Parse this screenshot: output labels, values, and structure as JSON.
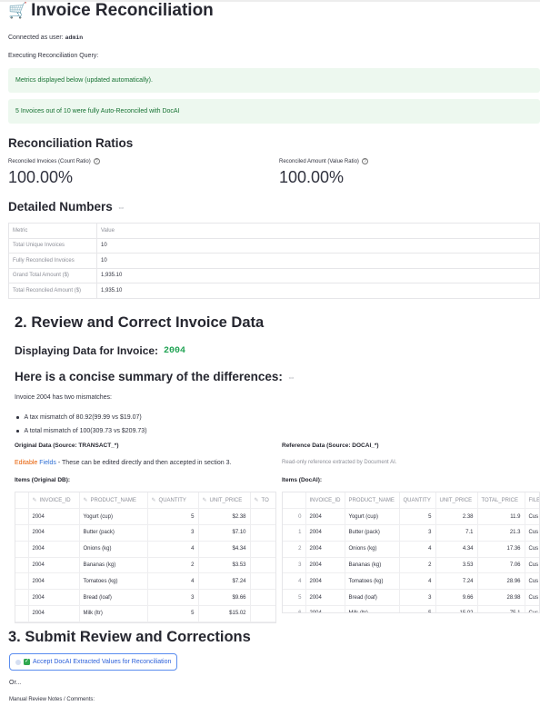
{
  "header": {
    "icon": "cart-icon",
    "title": "Invoice Reconciliation"
  },
  "connection": {
    "label": "Connected as user:",
    "user": "admin"
  },
  "executing": "Executing Reconciliation Query:",
  "alerts": {
    "metrics_note": "Metrics displayed below (updated automatically).",
    "auto_reconciled": "5 Invoices out of 10 were fully Auto-Reconciled with DocAI"
  },
  "ratios": {
    "heading": "Reconciliation Ratios",
    "count_label": "Reconciled Invoices (Count Ratio)",
    "count_value": "100.00%",
    "amount_label": "Reconciled Amount (Value Ratio)",
    "amount_value": "100.00%"
  },
  "detailed": {
    "heading": "Detailed Numbers",
    "columns": [
      "Metric",
      "Value"
    ],
    "rows": [
      {
        "metric": "Total Unique Invoices",
        "value": "10"
      },
      {
        "metric": "Fully Reconciled Invoices",
        "value": "10"
      },
      {
        "metric": "Grand Total Amount ($)",
        "value": "1,935.10"
      },
      {
        "metric": "Total Reconciled Amount ($)",
        "value": "1,935.10"
      }
    ]
  },
  "review": {
    "heading": "2. Review and Correct Invoice Data",
    "displaying_label": "Displaying Data for Invoice:",
    "invoice_id": "2004",
    "summary_heading": "Here is a concise summary of the differences:",
    "summary_text": "Invoice 2004 has two mismatches:",
    "bullets": [
      "A tax mismatch of 80.92(99.99 vs $19.07)",
      "A total mismatch of 100(309.73 vs $209.73)"
    ],
    "original_heading": "Original Data (Source: TRANSACT_*)",
    "reference_heading": "Reference Data (Source: DOCAI_*)",
    "editable_word1": "Editable",
    "editable_word2": "Fields",
    "editable_rest": " - These can be edited directly and then accepted in section 3.",
    "readonly_note": "Read-only reference extracted by Document AI.",
    "items_original_heading": "Items (Original DB):",
    "items_docai_heading": "Items (DocAI):"
  },
  "original_grid": {
    "columns": [
      "INVOICE_ID",
      "PRODUCT_NAME",
      "QUANTITY",
      "UNIT_PRICE",
      "TO"
    ],
    "rows": [
      [
        "2004",
        "Yogurt (cup)",
        "5",
        "$2.38"
      ],
      [
        "2004",
        "Butter (pack)",
        "3",
        "$7.10"
      ],
      [
        "2004",
        "Onions (kg)",
        "4",
        "$4.34"
      ],
      [
        "2004",
        "Bananas (kg)",
        "2",
        "$3.53"
      ],
      [
        "2004",
        "Tomatoes (kg)",
        "4",
        "$7.24"
      ],
      [
        "2004",
        "Bread (loaf)",
        "3",
        "$9.66"
      ],
      [
        "2004",
        "Milk (ltr)",
        "5",
        "$15.02"
      ]
    ]
  },
  "docai_grid": {
    "columns": [
      "",
      "INVOICE_ID",
      "PRODUCT_NAME",
      "QUANTITY",
      "UNIT_PRICE",
      "TOTAL_PRICE",
      "FILE"
    ],
    "rows": [
      [
        "0",
        "2004",
        "Yogurt (cup)",
        "5",
        "2.38",
        "11.9",
        "Cus"
      ],
      [
        "1",
        "2004",
        "Butter (pack)",
        "3",
        "7.1",
        "21.3",
        "Cus"
      ],
      [
        "2",
        "2004",
        "Onions (kg)",
        "4",
        "4.34",
        "17.36",
        "Cus"
      ],
      [
        "3",
        "2004",
        "Bananas (kg)",
        "2",
        "3.53",
        "7.06",
        "Cus"
      ],
      [
        "4",
        "2004",
        "Tomatoes (kg)",
        "4",
        "7.24",
        "28.96",
        "Cus"
      ],
      [
        "5",
        "2004",
        "Bread (loaf)",
        "3",
        "9.66",
        "28.98",
        "Cus"
      ],
      [
        "6",
        "2004",
        "Milk (ltr)",
        "5",
        "15.02",
        "75.1",
        "Cus"
      ]
    ]
  },
  "submit": {
    "heading": "3. Submit Review and Corrections",
    "accept_button": "Accept DocAI Extracted Values for Reconciliation",
    "or_text": "Or...",
    "notes_label": "Manual Review Notes / Comments:"
  },
  "colors": {
    "alert_bg": "#edf8ef",
    "alert_text": "#177233",
    "accent_blue": "#2b5fd9",
    "code_green": "#21a354"
  }
}
